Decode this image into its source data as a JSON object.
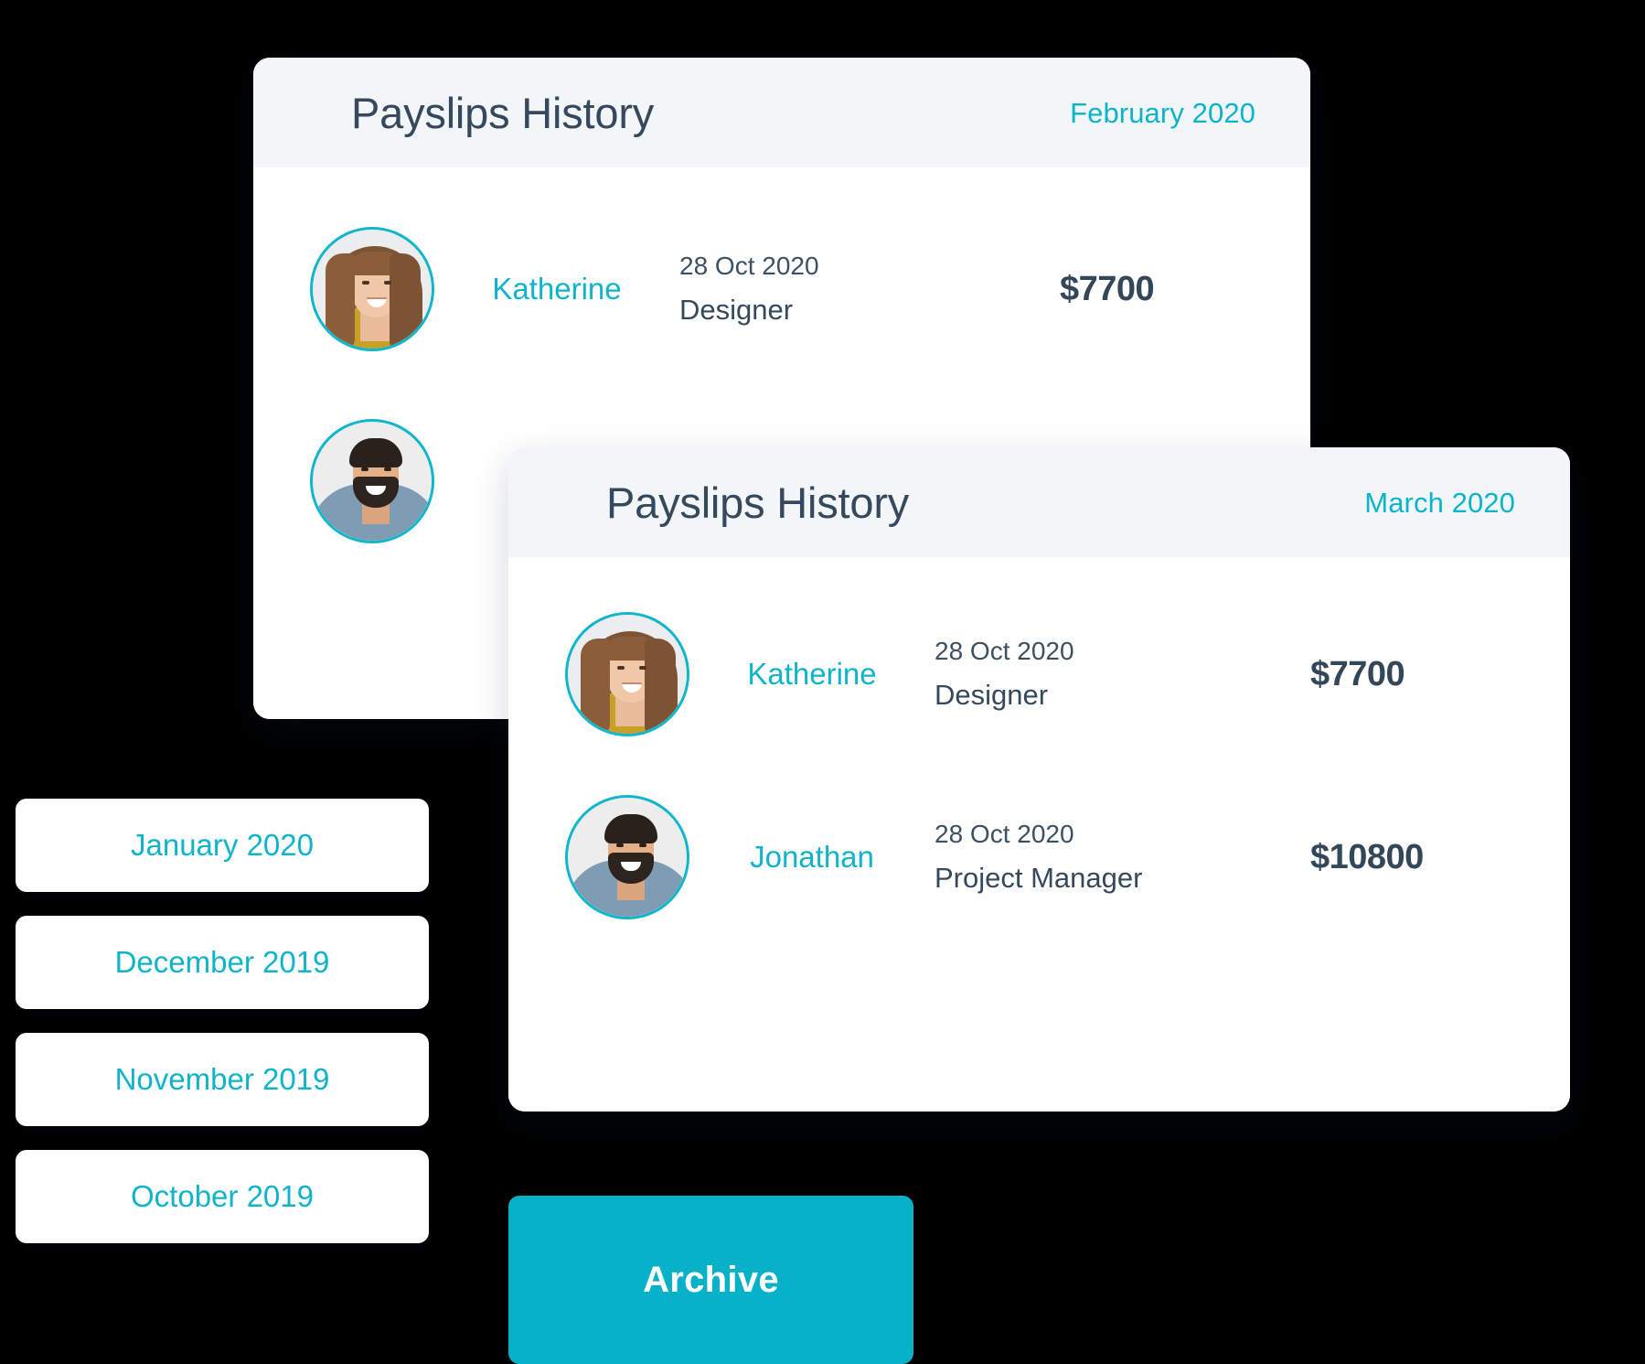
{
  "cards": [
    {
      "title": "Payslips History",
      "month": "February 2020",
      "rows": [
        {
          "avatar": "female-avatar",
          "name": "Katherine",
          "date": "28 Oct 2020",
          "role": "Designer",
          "amount": "$7700"
        },
        {
          "avatar": "male-avatar",
          "name": "",
          "date": "",
          "role": "",
          "amount": ""
        }
      ]
    },
    {
      "title": "Payslips History",
      "month": "March 2020",
      "rows": [
        {
          "avatar": "female-avatar",
          "name": "Katherine",
          "date": "28 Oct 2020",
          "role": "Designer",
          "amount": "$7700"
        },
        {
          "avatar": "male-avatar",
          "name": "Jonathan",
          "date": "28 Oct 2020",
          "role": "Project Manager",
          "amount": "$10800"
        }
      ]
    }
  ],
  "month_list": [
    {
      "label": "January 2020"
    },
    {
      "label": "December 2019"
    },
    {
      "label": "November 2019"
    },
    {
      "label": "October 2019"
    }
  ],
  "archive_button": {
    "label": "Archive"
  },
  "colors": {
    "accent": "#0fb4ca",
    "accent_button": "#07b2c8",
    "heading": "#36495c",
    "amount": "#334759",
    "card_header_bg": "#f2f6f9",
    "card_bg": "#ffffff",
    "page_bg": "#000000"
  }
}
